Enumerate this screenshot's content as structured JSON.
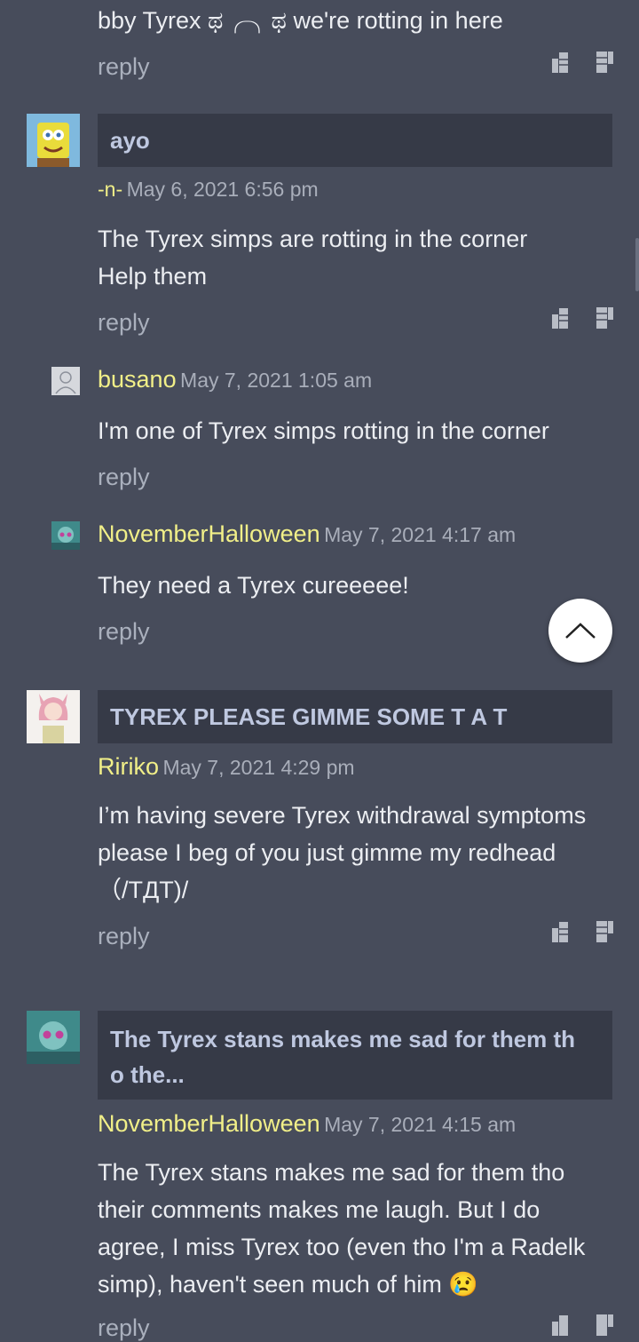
{
  "comments": [
    {
      "text": "bby Tyrex ಥ╭╮ಥ we're rotting in here",
      "reply": "reply"
    },
    {
      "title": "ayo",
      "author": "-n-",
      "date": "May 6, 2021 6:56 pm",
      "text_lines": [
        "The Tyrex simps are rotting in the corner",
        "Help them"
      ],
      "reply": "reply",
      "avatar": "spongebob-avatar"
    },
    {
      "author": "busano",
      "date": "May 7, 2021 1:05 am",
      "text": "I'm one of Tyrex simps rotting in the corner",
      "reply": "reply",
      "avatar": "default-user-avatar"
    },
    {
      "author": "NovemberHalloween",
      "date": "May 7, 2021 4:17 am",
      "text": "They need a Tyrex cureeeee!",
      "reply": "reply",
      "avatar": "teal-anime-avatar"
    },
    {
      "title": "TYREX PLEASE GIMME SOME T A T",
      "author": "Ririko",
      "date": "May 7, 2021 4:29 pm",
      "text_lines": [
        "I’m having severe Tyrex withdrawal symptoms",
        "please I beg of you just gimme my redhead",
        "（/TДT)/"
      ],
      "reply": "reply",
      "avatar": "pink-anime-avatar"
    },
    {
      "title_lines": [
        "The Tyrex stans makes me sad for them th",
        "o the..."
      ],
      "author": "NovemberHalloween",
      "date": "May 7, 2021 4:15 am",
      "text_lines": [
        "The Tyrex stans makes me sad for them tho",
        "their comments makes me laugh. But I do",
        "agree, I miss Tyrex too (even tho I'm a Radelk",
        "simp), haven't seen much of him"
      ],
      "emoji": "😢",
      "reply": "reply",
      "avatar": "teal-anime-avatar"
    }
  ],
  "colors": {
    "background": "#474c5b",
    "title_box": "#363a47",
    "author": "#f1ef88"
  }
}
